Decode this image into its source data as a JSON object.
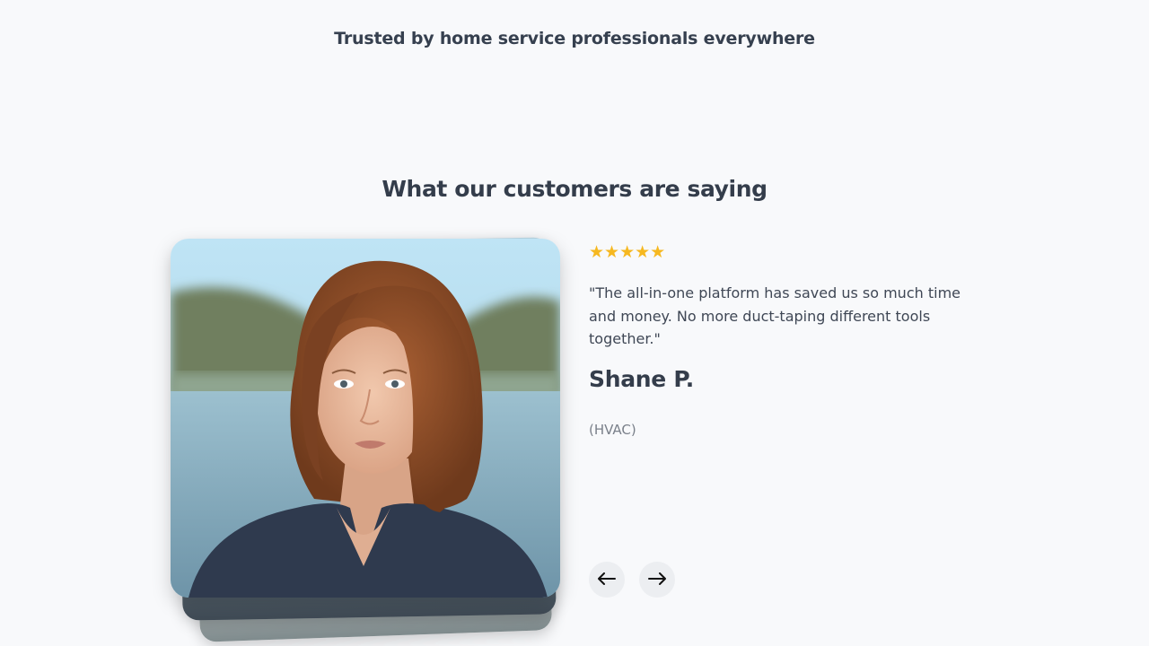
{
  "trusted_heading": "Trusted by home service professionals everywhere",
  "testimonials": {
    "title": "What our customers are saying",
    "stars": "★★★★★",
    "rating": 5,
    "quote": "\"The all-in-one platform has saved us so much time and money. No more duct-taping different tools together.\"",
    "author_name": "Shane P.",
    "author_role": "(HVAC)",
    "prev_icon": "arrow-left-icon",
    "next_icon": "arrow-right-icon"
  },
  "colors": {
    "background": "#f8f9fb",
    "heading": "#343d4b",
    "star": "#f6b820",
    "nav_button": "#eceef1"
  }
}
